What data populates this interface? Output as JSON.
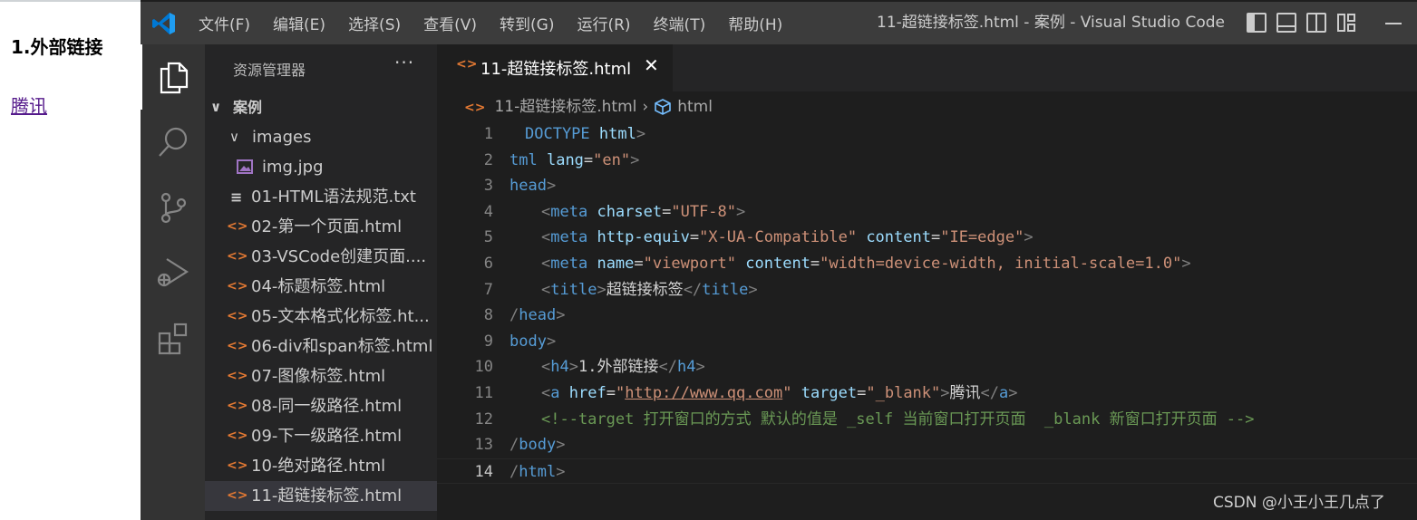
{
  "browser": {
    "heading": "1.外部链接",
    "link_text": "腾讯"
  },
  "titlebar": {
    "menu": [
      "文件(F)",
      "编辑(E)",
      "选择(S)",
      "查看(V)",
      "转到(G)",
      "运行(R)",
      "终端(T)",
      "帮助(H)"
    ],
    "window_title": "11-超链接标签.html - 案例 - Visual Studio Code"
  },
  "colors": {
    "titlebar": "#3c3c3c",
    "activity_bar": "#333333",
    "sidebar": "#252526",
    "editor": "#1e1e1e",
    "html_icon": "#e37933",
    "tag": "#569cd6",
    "attribute": "#9cdcfe",
    "string": "#ce9178",
    "comment": "#6a9955"
  },
  "activity_bar": [
    "explorer-icon",
    "search-icon",
    "source-control-icon",
    "run-debug-icon",
    "extensions-icon"
  ],
  "sidebar": {
    "title": "资源管理器",
    "more": "···",
    "root": "案例",
    "items": [
      {
        "label": "images",
        "type": "folder"
      },
      {
        "label": "img.jpg",
        "type": "image"
      },
      {
        "label": "01-HTML语法规范.txt",
        "type": "txt"
      },
      {
        "label": "02-第一个页面.html",
        "type": "html"
      },
      {
        "label": "03-VSCode创建页面....",
        "type": "html"
      },
      {
        "label": "04-标题标签.html",
        "type": "html"
      },
      {
        "label": "05-文本格式化标签.ht...",
        "type": "html"
      },
      {
        "label": "06-div和span标签.html",
        "type": "html"
      },
      {
        "label": "07-图像标签.html",
        "type": "html"
      },
      {
        "label": "08-同一级路径.html",
        "type": "html"
      },
      {
        "label": "09-下一级路径.html",
        "type": "html"
      },
      {
        "label": "10-绝对路径.html",
        "type": "html"
      },
      {
        "label": "11-超链接标签.html",
        "type": "html"
      }
    ]
  },
  "editor": {
    "tab_label": "11-超链接标签.html",
    "tab_close": "✕",
    "breadcrumb_file": "11-超链接标签.html",
    "breadcrumb_sep": "›",
    "breadcrumb_symbol": "html",
    "line_numbers": [
      "1",
      "2",
      "3",
      "4",
      "5",
      "6",
      "7",
      "8",
      "9",
      "10",
      "11",
      "12",
      "13",
      "14"
    ],
    "current_line": "14"
  },
  "watermark": "CSDN @小王小王几点了"
}
